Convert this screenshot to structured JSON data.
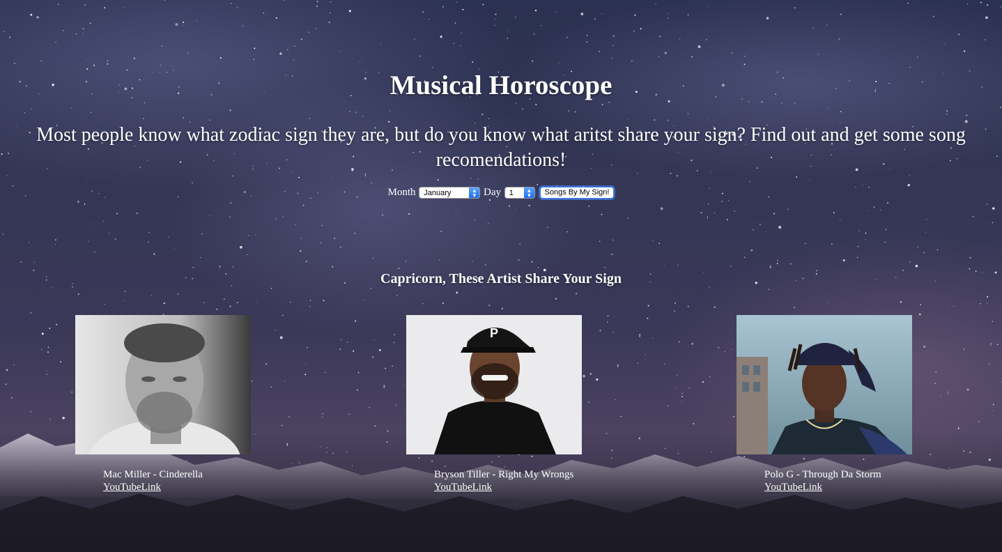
{
  "header": {
    "title": "Musical Horoscope",
    "subtitle": "Most people know what zodiac sign they are, but do you know what aritst share your sign? Find out and get some song recomendations!"
  },
  "form": {
    "month_label": "Month",
    "month_value": "January",
    "day_label": "Day",
    "day_value": "1",
    "submit_label": "Songs By My Sign!"
  },
  "results": {
    "heading": "Capricorn, These Artist Share Your Sign",
    "cards": [
      {
        "caption": "Mac Miller - Cinderella",
        "link": "YouTubeLink"
      },
      {
        "caption": "Bryson Tiller - Right My Wrongs",
        "link": "YouTubeLink"
      },
      {
        "caption": "Polo G - Through Da Storm",
        "link": "YouTubeLink"
      }
    ]
  },
  "colors": {
    "text": "#ffffff",
    "accent": "#1d6df2"
  }
}
